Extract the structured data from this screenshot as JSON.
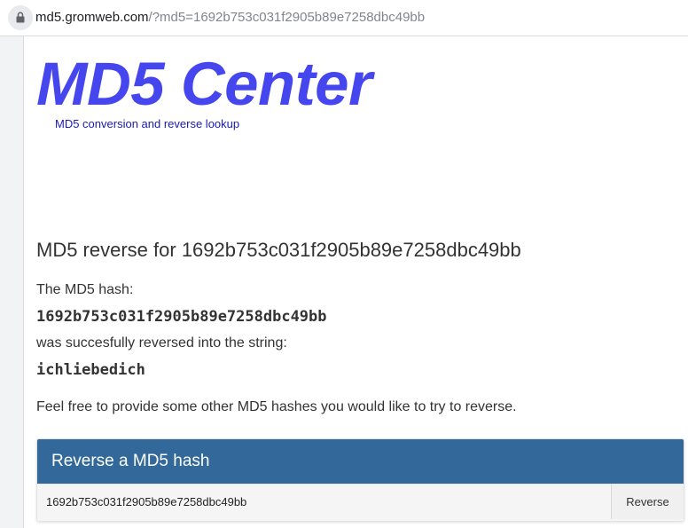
{
  "browser": {
    "url_host": "md5.gromweb.com",
    "url_path": "/?md5=1692b753c031f2905b89e7258dbc49bb",
    "lock_icon": "lock-icon"
  },
  "site": {
    "logo": "MD5 Center",
    "tagline": "MD5 conversion and reverse lookup",
    "logo_color": "#4646ef"
  },
  "result": {
    "heading": "MD5 reverse for 1692b753c031f2905b89e7258dbc49bb",
    "hash_label": "The MD5 hash:",
    "hash": "1692b753c031f2905b89e7258dbc49bb",
    "reversed_label": "was succesfully reversed into the string:",
    "reversed_string": "ichliebedich",
    "invite": "Feel free to provide some other MD5 hashes you would like to try to reverse."
  },
  "reverse_form": {
    "title": "Reverse a MD5 hash",
    "input_value": "1692b753c031f2905b89e7258dbc49bb",
    "button_label": "Reverse",
    "header_color": "#33699a"
  }
}
